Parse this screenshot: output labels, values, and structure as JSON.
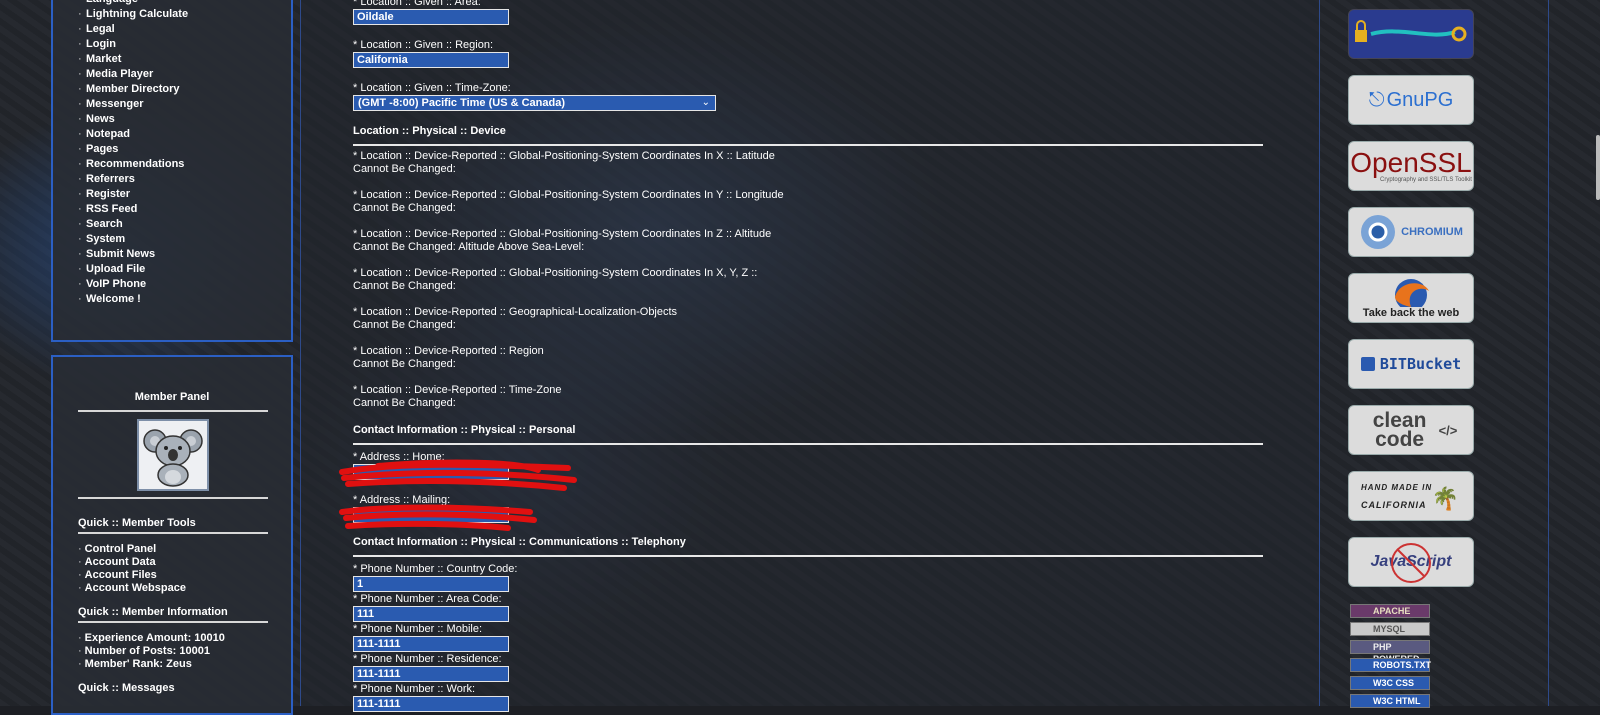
{
  "nav": {
    "items": [
      "Language",
      "Lightning Calculate",
      "Legal",
      "Login",
      "Market",
      "Media Player",
      "Member Directory",
      "Messenger",
      "News",
      "Notepad",
      "Pages",
      "Recommendations",
      "Referrers",
      "Register",
      "RSS Feed",
      "Search",
      "System",
      "Submit News",
      "Upload File",
      "VoIP Phone",
      "Welcome !"
    ]
  },
  "member": {
    "title": "Member Panel",
    "tools_label": "Quick :: Member Tools",
    "tools": [
      "Control Panel",
      "Account Data",
      "Account Files",
      "Account Webspace"
    ],
    "info_label": "Quick :: Member Information",
    "info": [
      "Experience Amount: 10010",
      "Number of Posts: 10001",
      "Member' Rank: Zeus"
    ],
    "messages_label": "Quick :: Messages"
  },
  "form": {
    "area_label": "* Location :: Given :: Area:",
    "area_value": "Oildale",
    "region_label": "* Location :: Given :: Region:",
    "region_value": "California",
    "tz_label": "* Location :: Given :: Time-Zone:",
    "tz_value": "(GMT -8:00) Pacific Time (US & Canada)",
    "device_title": "Location :: Physical :: Device",
    "device_rows": [
      {
        "label": "* Location :: Device-Reported :: Global-Positioning-System Coordinates In X :: Latitude",
        "value": "Cannot Be Changed:"
      },
      {
        "label": "* Location :: Device-Reported :: Global-Positioning-System Coordinates In Y :: Longitude",
        "value": "Cannot Be Changed:"
      },
      {
        "label": "* Location :: Device-Reported :: Global-Positioning-System Coordinates In Z :: Altitude",
        "value": "Cannot Be Changed: Altitude Above Sea-Level:"
      },
      {
        "label": "* Location :: Device-Reported :: Global-Positioning-System Coordinates In X, Y, Z ::",
        "value": "Cannot Be Changed:"
      },
      {
        "label": "* Location :: Device-Reported :: Geographical-Localization-Objects",
        "value": "Cannot Be Changed:"
      },
      {
        "label": "* Location :: Device-Reported :: Region",
        "value": "Cannot Be Changed:"
      },
      {
        "label": "* Location :: Device-Reported :: Time-Zone",
        "value": "Cannot Be Changed:"
      }
    ],
    "contact_title": "Contact Information :: Physical :: Personal",
    "home_label": "* Address :: Home:",
    "mailing_label": "* Address :: Mailing:",
    "tel_title": "Contact Information :: Physical :: Communications :: Telephony",
    "country_label": "* Phone Number :: Country Code:",
    "country_value": "1",
    "area_code_label": "* Phone Number :: Area Code:",
    "area_code_value": "111",
    "mobile_label": "* Phone Number :: Mobile:",
    "mobile_value": "111-1111",
    "residence_label": "* Phone Number :: Residence:",
    "residence_value": "111-1111",
    "work_label": "* Phone Number :: Work:",
    "work_value": "111-1111"
  },
  "badges": {
    "gnupg": "GnuPG",
    "openssl": "OpenSSL",
    "openssl_sub": "Cryptography and SSL/TLS Toolkit",
    "chromium": "CHROMIUM",
    "firefox": "Take back the web",
    "bitbucket": "BITBucket",
    "cleancode": "clean code",
    "handmade_1": "HAND MADE IN",
    "handmade_2": "CALIFORNIA",
    "javascript": "JavaScript",
    "mini": [
      "APACHE",
      "MYSQL",
      "PHP POWERED",
      "ROBOTS.TXT",
      "W3C CSS",
      "W3C HTML"
    ]
  }
}
